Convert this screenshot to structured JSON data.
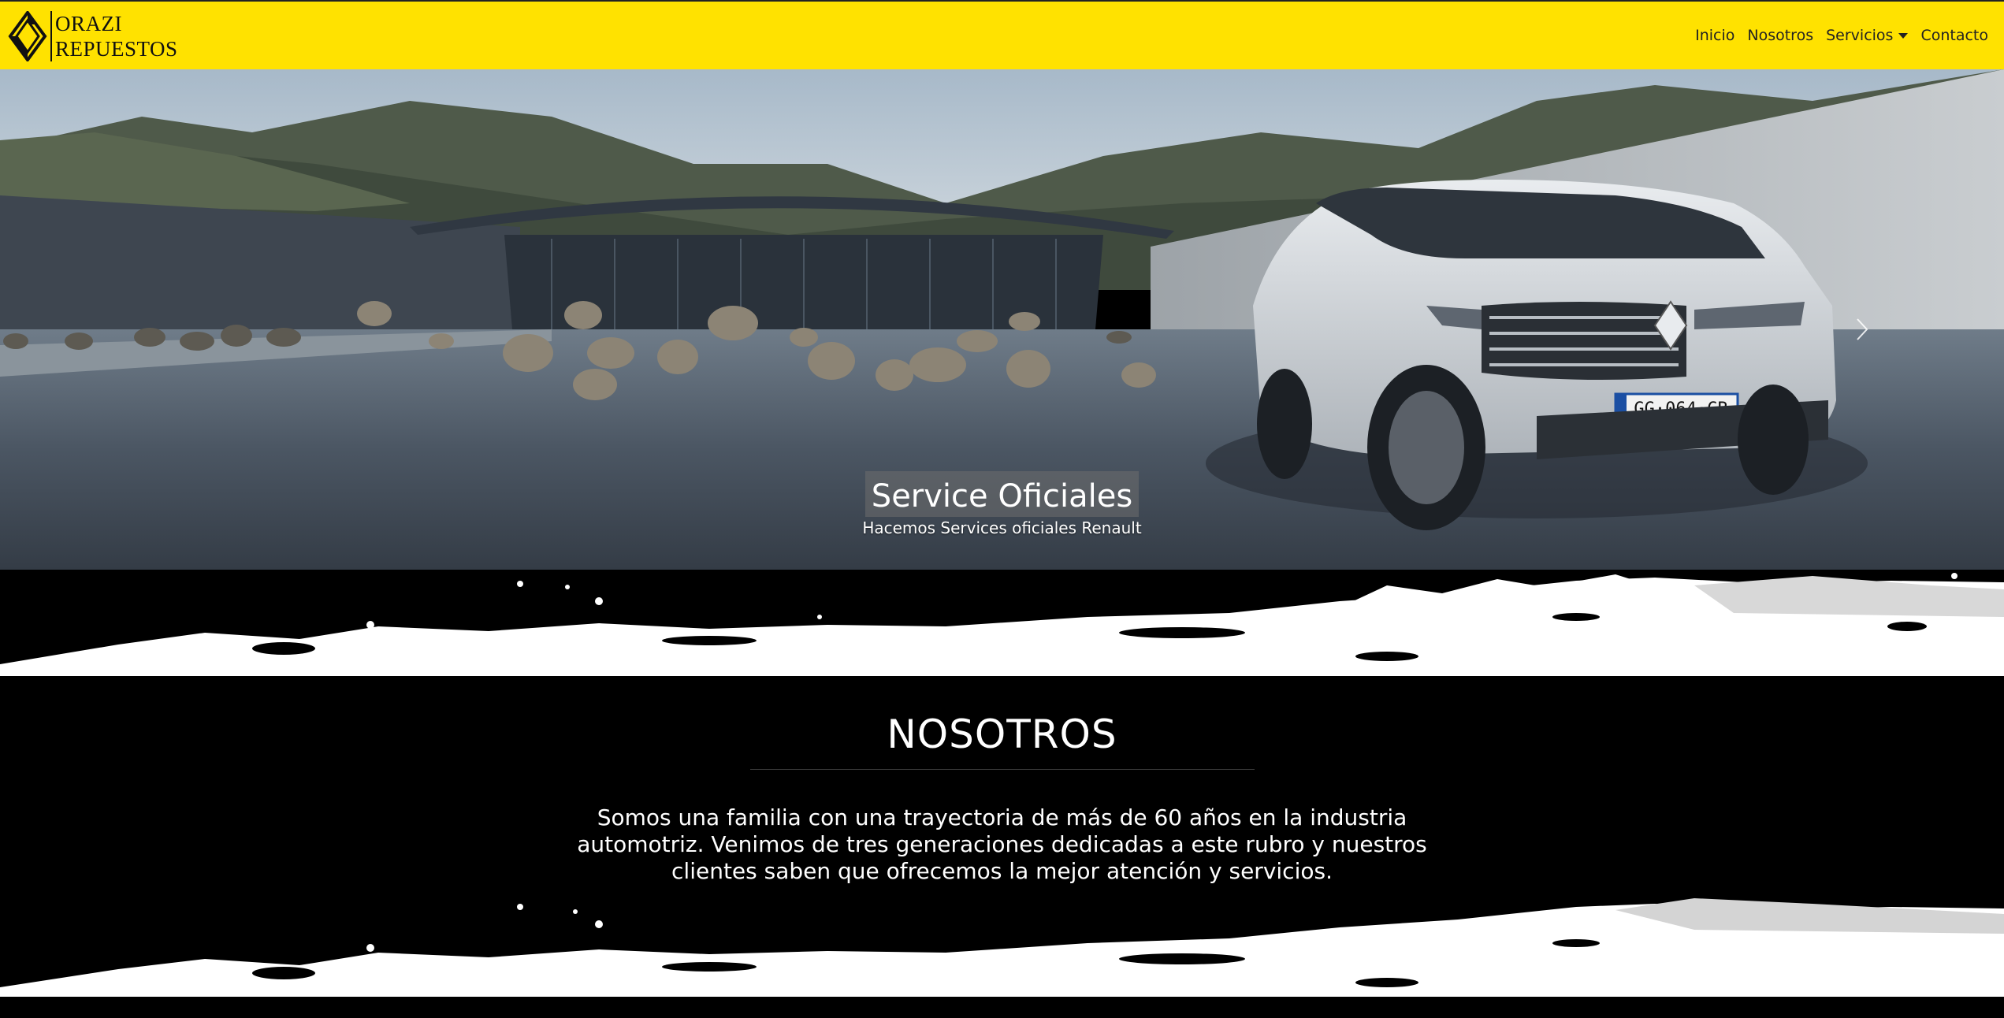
{
  "navbar": {
    "brand_line1": "ORAZI",
    "brand_line2": "REPUESTOS",
    "brand_logo_icon": "renault-diamond-icon",
    "links": [
      {
        "label": "Inicio"
      },
      {
        "label": "Nosotros"
      },
      {
        "label": "Servicios",
        "has_dropdown": true
      },
      {
        "label": "Contacto"
      }
    ],
    "background_color": "#ffe200"
  },
  "hero": {
    "caption_title": "Service Oficiales",
    "caption_subtitle": "Hacemos Services oficiales Renault",
    "plate_text": "GG·064·CB",
    "next_icon": "chevron-right-icon",
    "indicators": [
      {
        "active": false
      },
      {
        "active": true
      },
      {
        "active": false
      }
    ]
  },
  "nosotros": {
    "title": "NOSOTROS",
    "text": "Somos una familia con una trayectoria de más de 60 años en la industria automotriz. Venimos de tres generaciones dedicadas a este rubro y nuestros clientes saben que ofrecemos la mejor atención y servicios."
  }
}
